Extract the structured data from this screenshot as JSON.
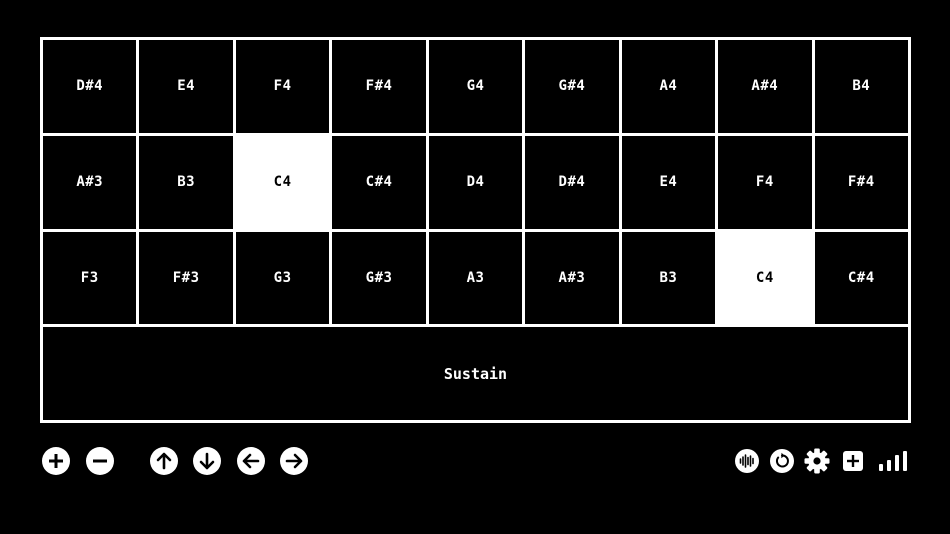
{
  "colors": {
    "background": "#000000",
    "foreground": "#ffffff",
    "active_key": "#ffffff"
  },
  "keyboard": {
    "rows": [
      [
        {
          "note": "D#4",
          "active": false
        },
        {
          "note": "E4",
          "active": false
        },
        {
          "note": "F4",
          "active": false
        },
        {
          "note": "F#4",
          "active": false
        },
        {
          "note": "G4",
          "active": false
        },
        {
          "note": "G#4",
          "active": false
        },
        {
          "note": "A4",
          "active": false
        },
        {
          "note": "A#4",
          "active": false
        },
        {
          "note": "B4",
          "active": false
        }
      ],
      [
        {
          "note": "A#3",
          "active": false
        },
        {
          "note": "B3",
          "active": false
        },
        {
          "note": "C4",
          "active": true
        },
        {
          "note": "C#4",
          "active": false
        },
        {
          "note": "D4",
          "active": false
        },
        {
          "note": "D#4",
          "active": false
        },
        {
          "note": "E4",
          "active": false
        },
        {
          "note": "F4",
          "active": false
        },
        {
          "note": "F#4",
          "active": false
        }
      ],
      [
        {
          "note": "F3",
          "active": false
        },
        {
          "note": "F#3",
          "active": false
        },
        {
          "note": "G3",
          "active": false
        },
        {
          "note": "G#3",
          "active": false
        },
        {
          "note": "A3",
          "active": false
        },
        {
          "note": "A#3",
          "active": false
        },
        {
          "note": "B3",
          "active": false
        },
        {
          "note": "C4",
          "active": true
        },
        {
          "note": "C#4",
          "active": false
        }
      ]
    ],
    "sustain_label": "Sustain"
  },
  "toolbar": {
    "left": [
      {
        "name": "zoom-in-button",
        "icon": "plus-circle-icon"
      },
      {
        "name": "zoom-out-button",
        "icon": "minus-circle-icon"
      },
      {
        "name": "move-up-button",
        "icon": "arrow-up-circle-icon"
      },
      {
        "name": "move-down-button",
        "icon": "arrow-down-circle-icon"
      },
      {
        "name": "move-left-button",
        "icon": "arrow-left-circle-icon"
      },
      {
        "name": "move-right-button",
        "icon": "arrow-right-circle-icon"
      }
    ],
    "right": [
      {
        "name": "audio-button",
        "icon": "waveform-icon"
      },
      {
        "name": "reset-button",
        "icon": "rotate-icon"
      },
      {
        "name": "settings-button",
        "icon": "gear-icon"
      },
      {
        "name": "add-button",
        "icon": "plus-square-icon"
      },
      {
        "name": "signal-button",
        "icon": "signal-bars-icon"
      }
    ]
  }
}
